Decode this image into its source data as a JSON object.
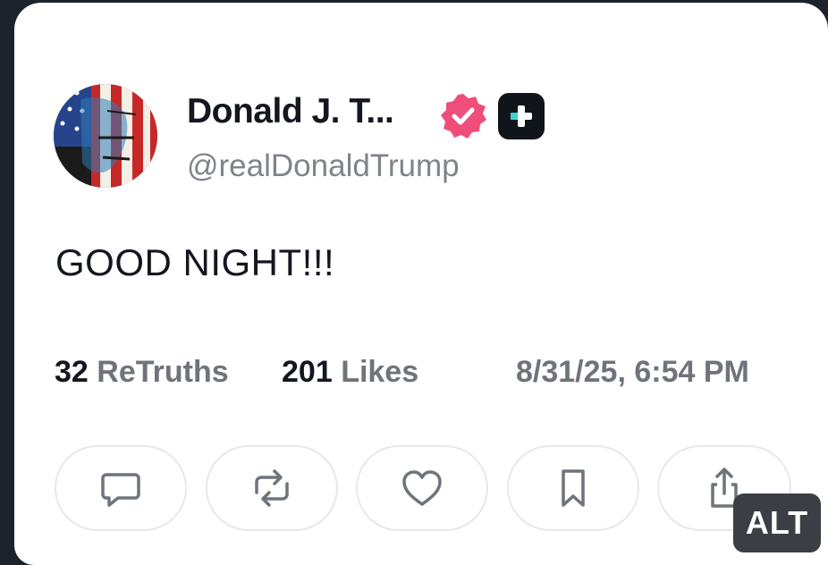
{
  "post": {
    "display_name": "Donald J. T...",
    "handle": "@realDonaldTrump",
    "verified_icon": "verified-badge-icon",
    "verified_color": "#ef4e7a",
    "extra_badge_icon": "plus-badge-icon",
    "text": "GOOD NIGHT!!!",
    "retruths_count": "32",
    "retruths_label": "ReTruths",
    "likes_count": "201",
    "likes_label": "Likes",
    "timestamp": "8/31/25, 6:54 PM"
  },
  "actions": [
    {
      "icon": "reply-icon"
    },
    {
      "icon": "retruth-icon"
    },
    {
      "icon": "like-icon"
    },
    {
      "icon": "bookmark-icon"
    },
    {
      "icon": "share-icon"
    }
  ],
  "alt_badge": {
    "label": "ALT"
  }
}
